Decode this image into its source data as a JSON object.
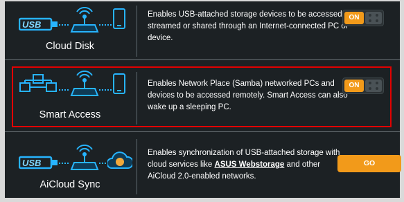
{
  "rows": [
    {
      "label": "Cloud Disk",
      "description": "Enables USB-attached storage devices to be accessed, streamed or shared through an Internet-connected PC or device.",
      "control": {
        "type": "toggle",
        "label": "ON",
        "state": "on"
      },
      "icons": [
        "usb-icon",
        "router-icon",
        "phone-icon"
      ]
    },
    {
      "label": "Smart Access",
      "description": "Enables Network Place (Samba) networked PCs and devices to be accessed remotely. Smart Access can also wake up a sleeping PC.",
      "control": {
        "type": "toggle",
        "label": "ON",
        "state": "on"
      },
      "icons": [
        "network-icon",
        "router-icon",
        "phone-icon"
      ],
      "highlighted": true
    },
    {
      "label": "AiCloud Sync",
      "description_before": "Enables synchronization of USB-attached storage with cloud services like ",
      "description_link": "ASUS Webstorage",
      "description_after": " and other AiCloud 2.0-enabled networks.",
      "control": {
        "type": "button",
        "label": "GO"
      },
      "icons": [
        "usb-icon",
        "router-icon",
        "cloud-icon"
      ]
    }
  ],
  "colors": {
    "background": "#1c2124",
    "accent": "#f29a1a",
    "highlight_border": "#e30000",
    "icon_glow": "#27b4ff"
  }
}
